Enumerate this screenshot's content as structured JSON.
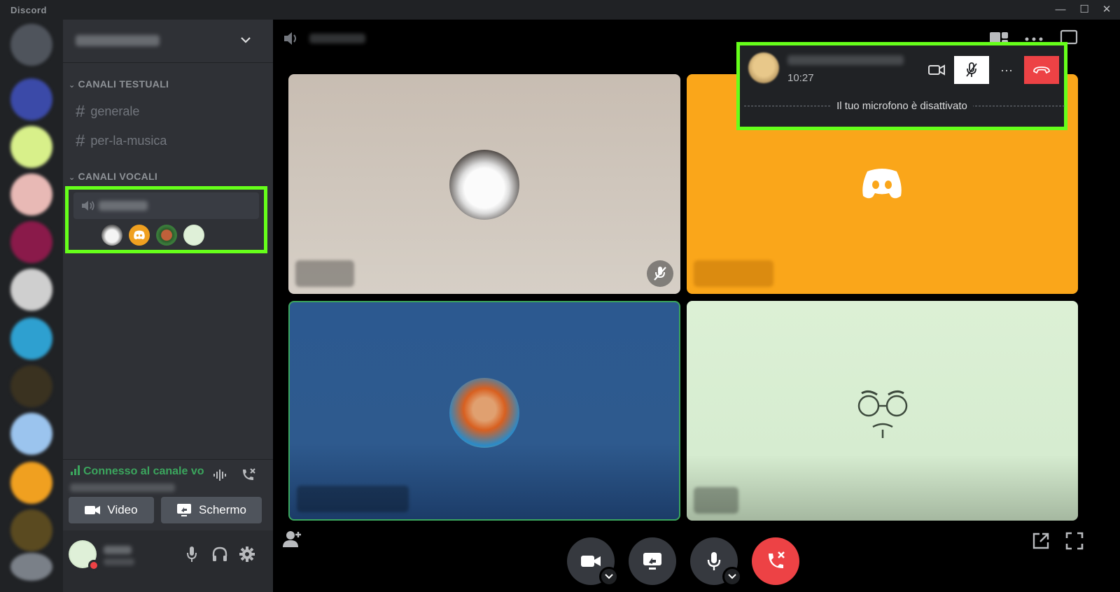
{
  "app": {
    "title": "Discord",
    "accent": "#5865f2",
    "highlight": "#66ff1a",
    "connected_color": "#3ba55d",
    "danger": "#ed4245"
  },
  "window": {
    "minimize": "—",
    "maximize": "☐",
    "close": "✕"
  },
  "channels": {
    "text_category": "CANALI TESTUALI",
    "voice_category": "CANALI VOCALI",
    "text_channels": [
      {
        "hash": "#",
        "name": "generale"
      },
      {
        "hash": "#",
        "name": "per-la-musica"
      }
    ]
  },
  "voice_panel": {
    "status": "Connesso al canale vo",
    "video_label": "Video",
    "screen_label": "Schermo"
  },
  "call_overlay": {
    "time": "10:27",
    "mic_message": "Il tuo microfono è disattivato",
    "more": "···"
  },
  "icons": [
    "speaker-icon",
    "chevron-down-icon",
    "grid-icon",
    "more-icon",
    "popout-icon",
    "camera-icon",
    "screen-share-icon",
    "mic-icon",
    "hangup-icon",
    "add-user-icon",
    "fullscreen-icon",
    "headphones-icon",
    "gear-icon",
    "signal-icon",
    "soundwave-icon",
    "mic-off-icon",
    "discord-logo-icon"
  ]
}
